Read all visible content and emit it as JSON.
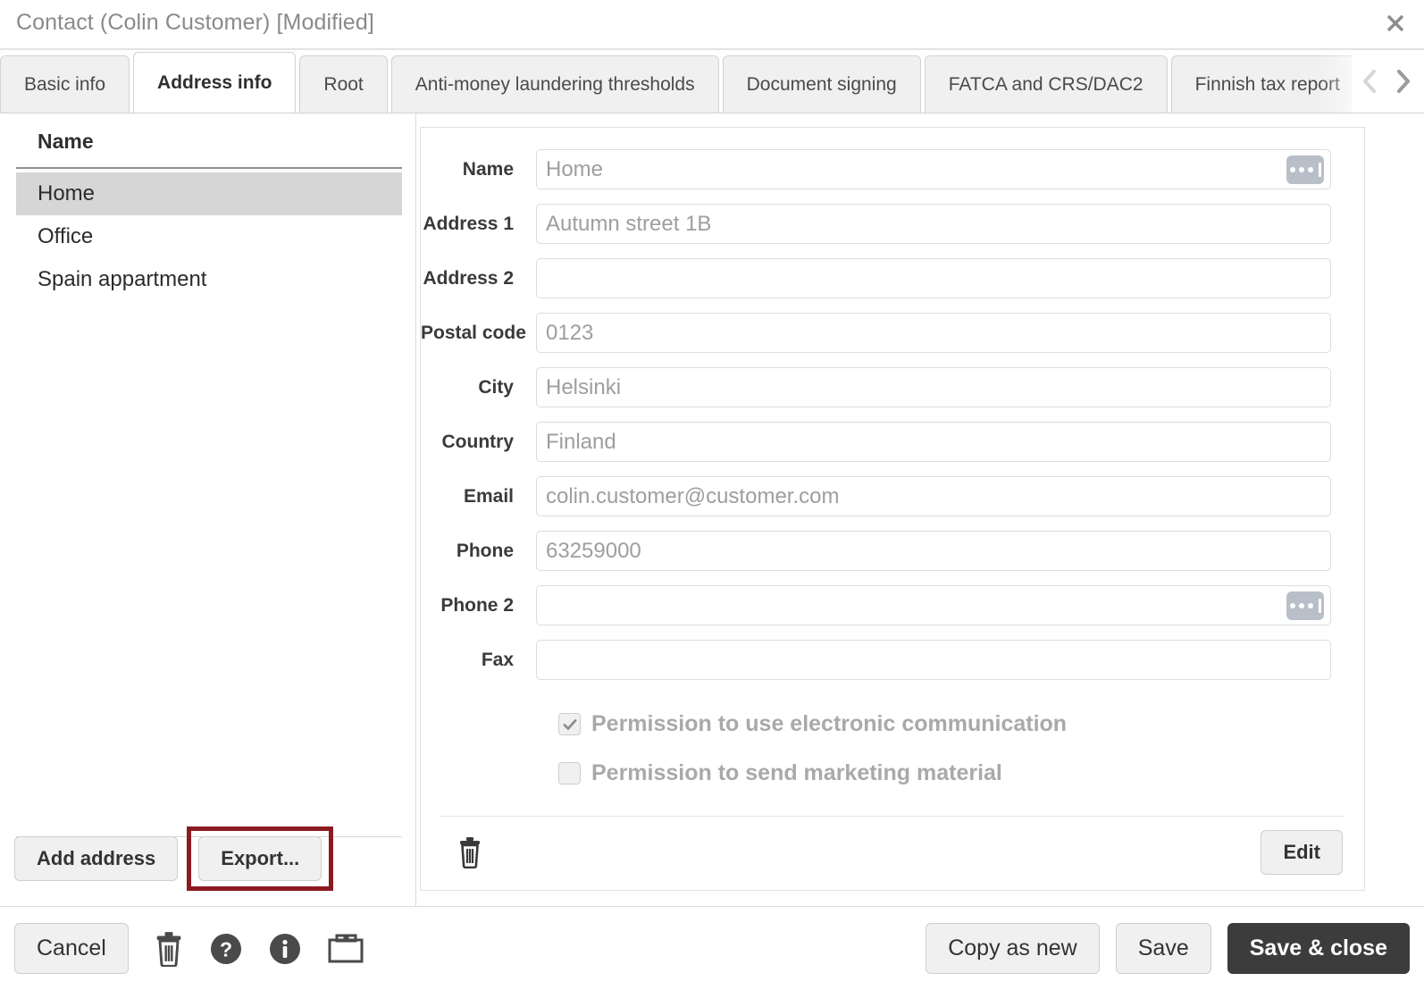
{
  "window": {
    "title": "Contact (Colin Customer) [Modified]",
    "close_icon": "close-icon"
  },
  "tabs": {
    "items": [
      {
        "label": "Basic info",
        "active": false
      },
      {
        "label": "Address info",
        "active": true
      },
      {
        "label": "Root",
        "active": false
      },
      {
        "label": "Anti-money laundering thresholds",
        "active": false
      },
      {
        "label": "Document signing",
        "active": false
      },
      {
        "label": "FATCA and CRS/DAC2",
        "active": false
      },
      {
        "label": "Finnish tax report",
        "active": false
      }
    ],
    "scroll_prev_icon": "chevron-left-icon",
    "scroll_next_icon": "chevron-right-icon"
  },
  "address_list": {
    "column_header": "Name",
    "items": [
      {
        "label": "Home",
        "selected": true
      },
      {
        "label": "Office",
        "selected": false
      },
      {
        "label": "Spain appartment",
        "selected": false
      }
    ],
    "add_button": "Add address",
    "export_button": "Export...",
    "highlight_color": "#8c1b20"
  },
  "form": {
    "fields": [
      {
        "label": "Name",
        "value": "Home",
        "has_ellipsis": true
      },
      {
        "label": "Address 1",
        "value": "Autumn street 1B",
        "has_ellipsis": false
      },
      {
        "label": "Address 2",
        "value": "",
        "has_ellipsis": false
      },
      {
        "label": "Postal code",
        "value": "0123",
        "has_ellipsis": false
      },
      {
        "label": "City",
        "value": "Helsinki",
        "has_ellipsis": false
      },
      {
        "label": "Country",
        "value": "Finland",
        "has_ellipsis": false
      },
      {
        "label": "Email",
        "value": "colin.customer@customer.com",
        "has_ellipsis": false
      },
      {
        "label": "Phone",
        "value": "63259000",
        "has_ellipsis": false
      },
      {
        "label": "Phone 2",
        "value": "",
        "has_ellipsis": true
      },
      {
        "label": "Fax",
        "value": "",
        "has_ellipsis": false
      }
    ],
    "checkboxes": [
      {
        "label": "Permission to use electronic communication",
        "checked": true
      },
      {
        "label": "Permission to send marketing material",
        "checked": false
      }
    ],
    "delete_icon": "trash-icon",
    "edit_button": "Edit"
  },
  "toolbar": {
    "cancel_label": "Cancel",
    "delete_icon": "trash-icon",
    "help_icon": "help-circle-icon",
    "info_icon": "info-circle-icon",
    "archive_icon": "folder-icon",
    "copy_as_new_label": "Copy as new",
    "save_label": "Save",
    "save_close_label": "Save & close",
    "primary_color": "#3c3c3c"
  }
}
